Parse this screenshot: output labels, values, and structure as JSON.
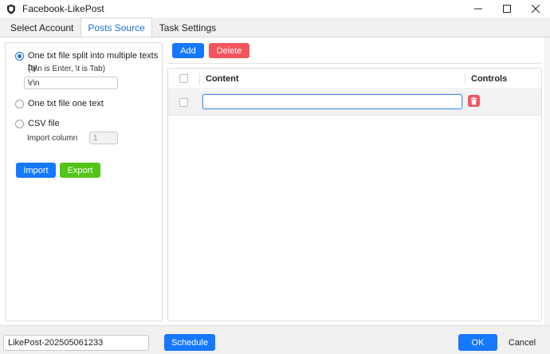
{
  "window": {
    "title": "Facebook-LikePost",
    "icon": "shield-icon",
    "controls": [
      "minimize-icon",
      "maximize-icon",
      "close-icon"
    ]
  },
  "tabs": [
    {
      "label": "Select Account",
      "active": false
    },
    {
      "label": "Posts Source",
      "active": true
    },
    {
      "label": "Task Settings",
      "active": false
    }
  ],
  "source": {
    "option1_label": "One txt file split into multiple texts by",
    "option1_hint": "(\\r\\n is Enter, \\t is Tab)",
    "separator_value": "\\r\\n",
    "option2_label": "One txt file one text",
    "option3_label": "CSV file",
    "import_column_label": "Import column",
    "import_column_value": "1",
    "selected_option": 1,
    "import_label": "Import",
    "export_label": "Export"
  },
  "toolbar": {
    "add_label": "Add",
    "delete_label": "Delete"
  },
  "table": {
    "columns": [
      "Content",
      "Controls"
    ],
    "rows": [
      {
        "content": "",
        "checked": false
      }
    ]
  },
  "footer": {
    "task_name": "LikePost-202505061233",
    "schedule_label": "Schedule",
    "ok_label": "OK",
    "cancel_label": "Cancel"
  },
  "colors": {
    "primary": "#1677ff",
    "success": "#52c41a",
    "danger": "#f4545d",
    "active_tab_text": "#1a73d9"
  }
}
